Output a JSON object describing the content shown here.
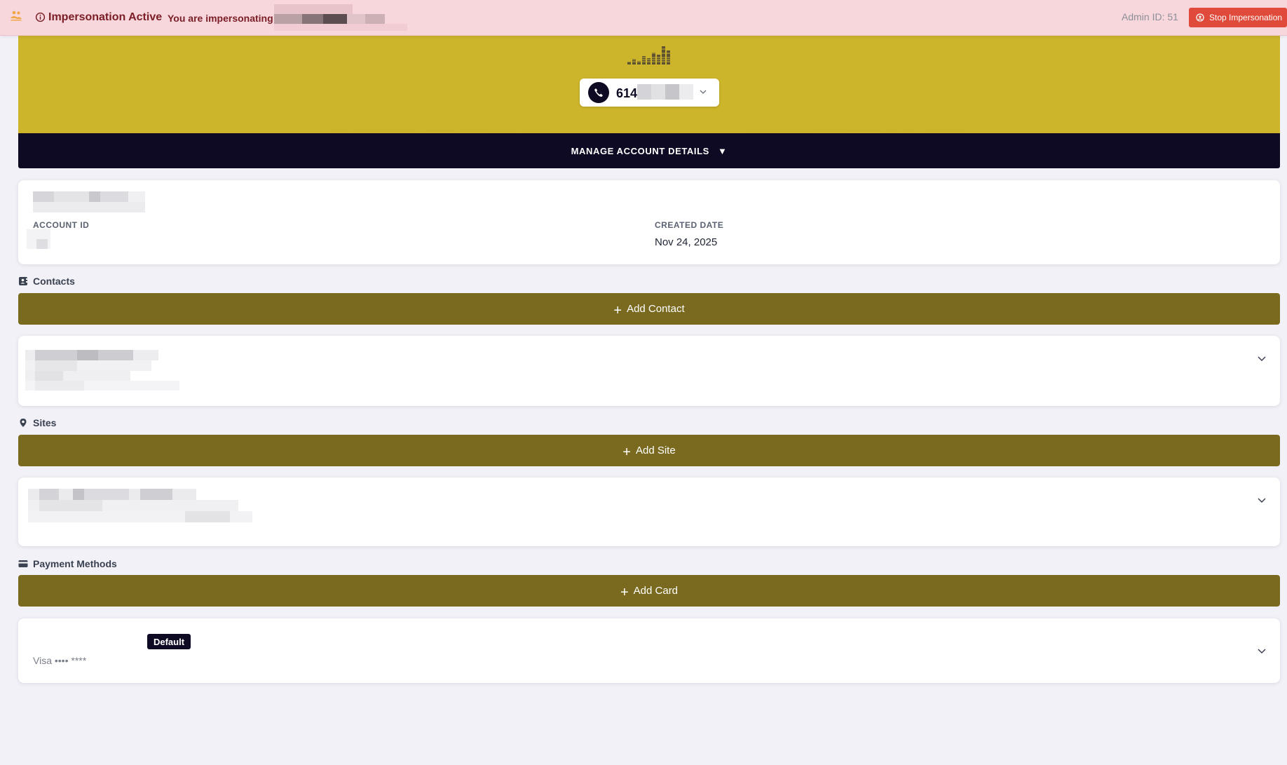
{
  "impersonation": {
    "title": "Impersonation Active",
    "description": "You are impersonating",
    "admin_id": "Admin ID: 51",
    "stop_button": "Stop Impersonation"
  },
  "hero": {
    "phone_number": "614",
    "brand_color": "#ccb42b"
  },
  "manage_account": {
    "label": "MANAGE ACCOUNT DETAILS",
    "caret": "▼"
  },
  "account": {
    "account_id_label": "ACCOUNT ID",
    "created_date_label": "CREATED DATE",
    "created_date_value": "Nov 24, 2025"
  },
  "contacts": {
    "title": "Contacts",
    "add_label": "Add Contact"
  },
  "sites": {
    "title": "Sites",
    "add_label": "Add Site"
  },
  "payment_methods": {
    "title": "Payment Methods",
    "add_label": "Add Card",
    "card": {
      "badge": "Default",
      "masked": "Visa •••• ****"
    }
  },
  "colors": {
    "navy": "#0e0a24",
    "olive": "#7a6a1f",
    "banner_bg": "#f7d6dc",
    "stop_red": "#e04a3a"
  },
  "icons": {
    "banner_logo": "users-icon",
    "info": "info-circle-icon",
    "stop": "user-x-icon",
    "phone": "phone-icon",
    "contacts": "address-book-icon",
    "sites": "map-pin-icon",
    "payment": "credit-card-icon",
    "expand": "chevron-down-icon"
  }
}
